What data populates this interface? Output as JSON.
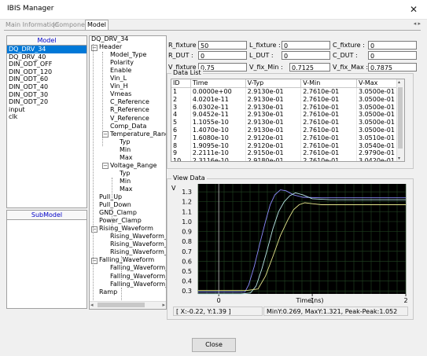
{
  "window": {
    "title": "IBIS Manager",
    "close_glyph": "✕"
  },
  "tabs": [
    {
      "label": "Main Information",
      "active": false
    },
    {
      "label": "Component",
      "active": false
    },
    {
      "label": "Model",
      "active": true
    }
  ],
  "tab_arrows": "◂ ▸",
  "model_list": {
    "header": "Model",
    "items": [
      "DQ_DRV_34",
      "DQ_DRV_40",
      "DIN_ODT_OFF",
      "DIN_ODT_120",
      "DIN_ODT_60",
      "DIN_ODT_40",
      "DIN_ODT_30",
      "DIN_ODT_20",
      "input",
      "clk"
    ],
    "selected": "DQ_DRV_34"
  },
  "submodel_list": {
    "header": "SubModel"
  },
  "tree": {
    "root": "DQ_DRV_34",
    "nodes": [
      "Header",
      "Model_Type",
      "Polarity",
      "Enable",
      "Vin_L",
      "Vin_H",
      "Vmeas",
      "C_Reference",
      "R_Reference",
      "V_Reference",
      "Comp_Data",
      "Temperature_Range",
      "Typ",
      "Min",
      "Max",
      "Voltage_Range",
      "Typ",
      "Min",
      "Max",
      "Pull_Up",
      "Pull_Down",
      "GND_Clamp",
      "Power_Clamp",
      "Rising_Waveform",
      "Rising_Waveform_1",
      "Rising_Waveform_2",
      "Rising_Waveform_3",
      "Falling_Waveform",
      "Falling_Waveform_1",
      "Falling_Waveform_2",
      "Falling_Waveform_3",
      "Ramp"
    ]
  },
  "params": {
    "r_fixture": {
      "label": "R_fixture :",
      "value": "50"
    },
    "l_fixture": {
      "label": "L_fixture :",
      "value": "0"
    },
    "c_fixture": {
      "label": "C_fixture :",
      "value": "0"
    },
    "r_dut": {
      "label": "R_DUT :",
      "value": "0"
    },
    "l_dut": {
      "label": "L_DUT :",
      "value": "0"
    },
    "c_dut": {
      "label": "C_DUT :",
      "value": "0"
    },
    "v_fixture": {
      "label": "V_fixture :",
      "value": "0.75"
    },
    "v_fix_min": {
      "label": "V_fix_Min :",
      "value": "0.7125"
    },
    "v_fix_max": {
      "label": "V_fix_Max :",
      "value": "0.7875"
    }
  },
  "data_list": {
    "title": "Data List",
    "columns": [
      "ID",
      "Time",
      "V-Typ",
      "V-Min",
      "V-Max"
    ],
    "rows": [
      [
        "1",
        "0.0000e+00",
        "2.9130e-01",
        "2.7610e-01",
        "3.0500e-01"
      ],
      [
        "2",
        "4.0201e-11",
        "2.9130e-01",
        "2.7610e-01",
        "3.0500e-01"
      ],
      [
        "3",
        "6.0302e-11",
        "2.9130e-01",
        "2.7610e-01",
        "3.0500e-01"
      ],
      [
        "4",
        "9.0452e-11",
        "2.9130e-01",
        "2.7610e-01",
        "3.0500e-01"
      ],
      [
        "5",
        "1.1055e-10",
        "2.9130e-01",
        "2.7610e-01",
        "3.0500e-01"
      ],
      [
        "6",
        "1.4070e-10",
        "2.9130e-01",
        "2.7610e-01",
        "3.0500e-01"
      ],
      [
        "7",
        "1.6080e-10",
        "2.9120e-01",
        "2.7610e-01",
        "3.0510e-01"
      ],
      [
        "8",
        "1.9095e-10",
        "2.9120e-01",
        "2.7610e-01",
        "3.0540e-01"
      ],
      [
        "9",
        "2.2111e-10",
        "2.9150e-01",
        "2.7610e-01",
        "2.9790e-01"
      ],
      [
        "10",
        "2.3116e-10",
        "2.9180e-01",
        "2.7610e-01",
        "3.0420e-01"
      ]
    ]
  },
  "view_data": {
    "title": "View Data",
    "status_left": "[ X:-0.22, Y:1.39 ]",
    "status_right": "MinY:0.269, MaxY:1.321, Peak-Peak:1.052"
  },
  "chart_data": {
    "type": "line",
    "xlabel": "Time(ns)",
    "ylabel": "V",
    "xlim": [
      -0.22,
      2.0
    ],
    "ylim": [
      0.27,
      1.38
    ],
    "x_ticks": [
      "0",
      "1",
      "2"
    ],
    "y_ticks": [
      "0.3",
      "0.4",
      "0.5",
      "0.6",
      "0.7",
      "0.8",
      "0.9",
      "1.0",
      "1.1",
      "1.2",
      "1.3"
    ],
    "grid": true,
    "background": "#000000",
    "series": [
      {
        "color": "#8c8cff",
        "x": [
          -0.22,
          0.18,
          0.28,
          0.32,
          0.38,
          0.44,
          0.5,
          0.55,
          0.6,
          0.66,
          0.72,
          0.8,
          0.9,
          1.1,
          1.5,
          2.0
        ],
        "y": [
          0.289,
          0.289,
          0.291,
          0.36,
          0.55,
          0.78,
          1.0,
          1.17,
          1.27,
          1.32,
          1.31,
          1.27,
          1.245,
          1.24,
          1.24,
          1.24
        ]
      },
      {
        "color": "#b8e6e6",
        "x": [
          -0.22,
          0.24,
          0.34,
          0.4,
          0.46,
          0.52,
          0.58,
          0.64,
          0.7,
          0.76,
          0.82,
          0.9,
          1.0,
          1.2,
          1.5,
          2.0
        ],
        "y": [
          0.27,
          0.27,
          0.28,
          0.35,
          0.52,
          0.72,
          0.93,
          1.1,
          1.2,
          1.26,
          1.29,
          1.27,
          1.23,
          1.22,
          1.22,
          1.22
        ]
      },
      {
        "color": "#e6e68c",
        "x": [
          -0.22,
          0.3,
          0.42,
          0.5,
          0.58,
          0.66,
          0.74,
          0.8,
          0.86,
          0.92,
          1.0,
          1.1,
          1.3,
          1.6,
          2.0
        ],
        "y": [
          0.305,
          0.305,
          0.32,
          0.45,
          0.65,
          0.86,
          1.02,
          1.12,
          1.17,
          1.19,
          1.18,
          1.17,
          1.17,
          1.17,
          1.17
        ]
      }
    ]
  },
  "footer": {
    "close_label": "Close"
  }
}
